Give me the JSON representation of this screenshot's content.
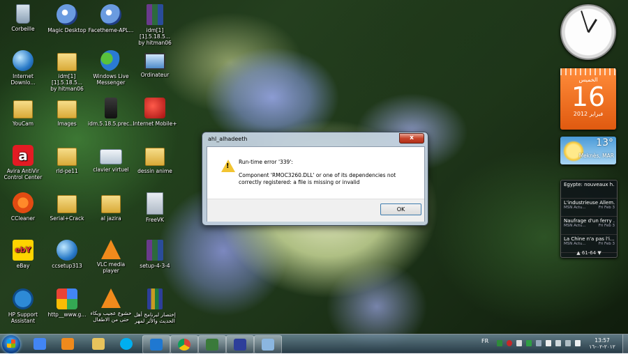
{
  "desktop_icons": [
    {
      "label": "Corbeille",
      "icon": "recycle-bin-icon"
    },
    {
      "label": "Magic Desktop",
      "icon": "magic-desktop-icon"
    },
    {
      "label": "Facetheme-APL...",
      "icon": "facetheme-icon"
    },
    {
      "label": "idm[1][1].5.18.5...\nby hitman06",
      "icon": "winrar-icon"
    },
    {
      "label": "Internet\nDownlo...",
      "icon": "internet-download-icon"
    },
    {
      "label": "idm[1][1].5.18.5...\nby hitman06",
      "icon": "folder-icon"
    },
    {
      "label": "Windows Live\nMessenger",
      "icon": "messenger-icon"
    },
    {
      "label": "Ordinateur",
      "icon": "computer-icon"
    },
    {
      "label": "YouCam",
      "icon": "folder-icon"
    },
    {
      "label": "Images",
      "icon": "folder-icon"
    },
    {
      "label": "idm.5.18.5.prec...",
      "icon": "idm-icon"
    },
    {
      "label": "Internet Mobile+",
      "icon": "internet-mobile-icon"
    },
    {
      "label": "Avira AntiVir\nControl Center",
      "icon": "avira-icon"
    },
    {
      "label": "rld-pe11",
      "icon": "folder-icon"
    },
    {
      "label": "clavier virtuel",
      "icon": "keyboard-icon"
    },
    {
      "label": "dessin anime",
      "icon": "folder-icon"
    },
    {
      "label": "CCleaner",
      "icon": "ccleaner-icon"
    },
    {
      "label": "Serial+Crack",
      "icon": "folder-icon"
    },
    {
      "label": "al jazira",
      "icon": "folder-icon"
    },
    {
      "label": "FreeVK",
      "icon": "document-icon"
    },
    {
      "label": "eBay",
      "icon": "ebay-icon"
    },
    {
      "label": "ccsetup313",
      "icon": "setup-icon"
    },
    {
      "label": "VLC media player",
      "icon": "vlc-icon"
    },
    {
      "label": "setup-4-3-4",
      "icon": "winrar-icon"
    },
    {
      "label": "HP Support\nAssistant",
      "icon": "hp-icon"
    },
    {
      "label": "http__www.g...",
      "icon": "google-icon"
    },
    {
      "label": "خشوع عجيب وبكاء\nحتى من الاطفال",
      "icon": "vlc-icon"
    },
    {
      "label": "إختصار لبرنامج أهل\nالحديث والأثر لمهر",
      "icon": "books-icon"
    }
  ],
  "gadgets": {
    "calendar": {
      "day": "الخميس",
      "date": "16",
      "month_year": "فبراير 2012"
    },
    "weather": {
      "temp": "13°",
      "city": "Meknès, MAR"
    },
    "news": {
      "items": [
        {
          "headline": "Egypte: nouveaux h...",
          "source": "",
          "date": ""
        },
        {
          "headline": "L'industrieuse Allem...",
          "source": "MSN Actu...",
          "date": "Fri Feb 3"
        },
        {
          "headline": "Naufrage d'un ferry ...",
          "source": "MSN Actu...",
          "date": "Fri Feb 3"
        },
        {
          "headline": "La Chine n'a pas l'i...",
          "source": "MSN Actu...",
          "date": "Fri Feb 3"
        }
      ],
      "pager": "61-64"
    }
  },
  "dialog": {
    "title": "ahl_alhadeeth",
    "error_title": "Run-time error '339':",
    "message": "Component 'RMOC3260.DLL' or one of its dependencies not correctly registered: a file is missing or invalid",
    "ok_label": "OK",
    "close_label": "x"
  },
  "taskbar": {
    "language": "FR",
    "time": "13:57",
    "date": "٢٠١٢-٠٢-١٦",
    "pinned": [
      {
        "name": "start-orb",
        "color": "#1e6fc0"
      },
      {
        "name": "google-icon",
        "color": "#4285f4"
      },
      {
        "name": "media-player-icon",
        "color": "#f08a1c"
      },
      {
        "name": "file-explorer-icon",
        "color": "#e7c35c"
      },
      {
        "name": "skype-icon",
        "color": "#00aff0"
      },
      {
        "name": "internet-explorer-icon",
        "color": "#1f78d1"
      },
      {
        "name": "chrome-icon",
        "color": "#db4437"
      },
      {
        "name": "app-icon",
        "color": "#3a7a3a"
      },
      {
        "name": "books-icon",
        "color": "#2d3e9a"
      },
      {
        "name": "paint-icon",
        "color": "#8bb6e0"
      }
    ]
  }
}
